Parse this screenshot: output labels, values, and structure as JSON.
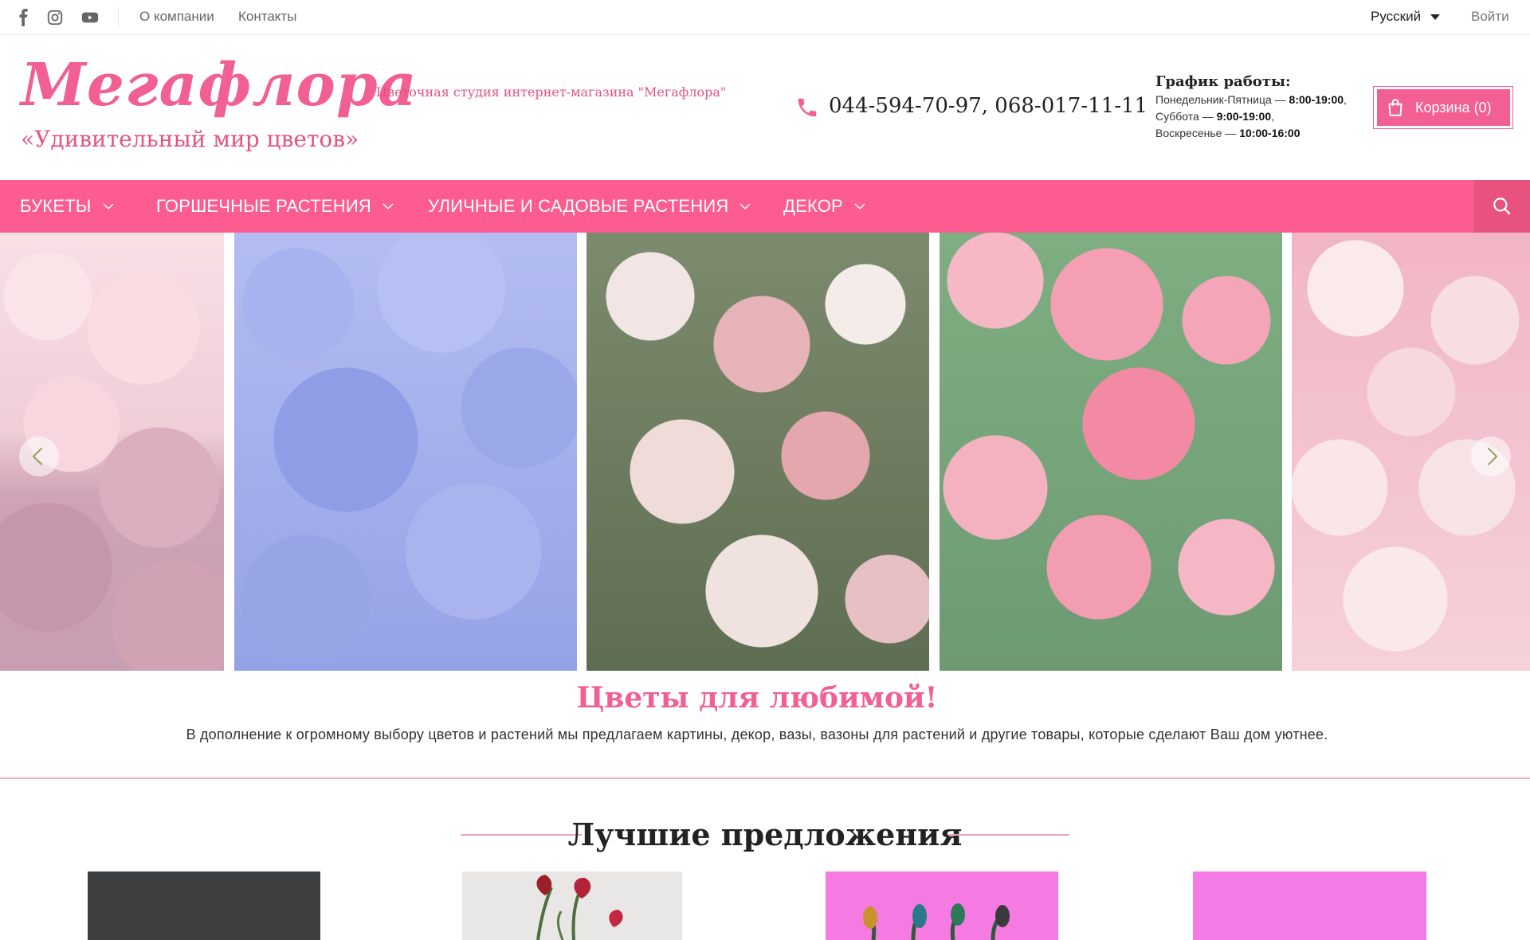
{
  "topbar": {
    "social_icons": [
      "facebook-icon",
      "instagram-icon",
      "youtube-icon"
    ],
    "links": [
      "О компании",
      "Контакты"
    ],
    "language": "Русский",
    "login": "Войти"
  },
  "header": {
    "logo_text": "Мегафлора",
    "slogan": "«Удивительный мир цветов»",
    "studio": "Цветочная студия интернет-магазина \"Мегафлора\"",
    "phone": "044-594-70-97, 068-017-11-11",
    "schedule": {
      "title": "График работы:",
      "rows": [
        {
          "day": "Понедельник-Пятница — ",
          "hours": "8:00-19:00",
          "tail": ","
        },
        {
          "day": "Суббота — ",
          "hours": "9:00-19:00",
          "tail": ","
        },
        {
          "day": "Воскресенье — ",
          "hours": "10:00-16:00",
          "tail": ""
        }
      ]
    },
    "cart_label": "Корзина (0)"
  },
  "nav": {
    "items": [
      "Букеты",
      "Горшечные растения",
      "Уличные и садовые растения",
      "Декор"
    ]
  },
  "slider": {
    "slides": [
      "carnations",
      "hydrangea",
      "blushing-bride-protea",
      "spray-roses",
      "bicolor-roses"
    ]
  },
  "intro": {
    "title": "Цветы для любимой!",
    "text": "В дополнение к огромному выбору цветов и растений мы предлагаем картины, декор, вазы, вазоны для растений и другие товары, которые сделают Ваш дом уютнее."
  },
  "best_offers": {
    "title": "Лучшие предложения",
    "products": 4
  },
  "colors": {
    "accent": "#fc5c8f",
    "brand": "#f25f93"
  }
}
